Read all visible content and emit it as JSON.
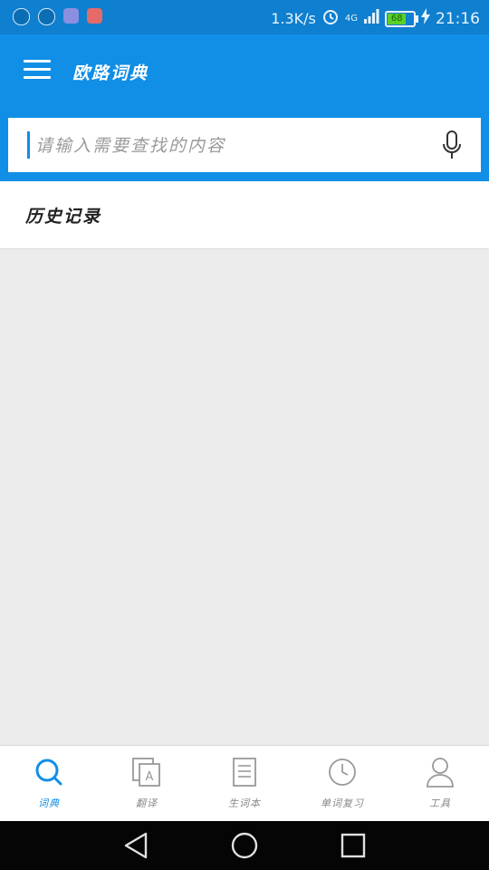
{
  "status_bar": {
    "net_speed": "1.3K/s",
    "network": "4G",
    "battery_level": "68",
    "time": "21:16"
  },
  "app_bar": {
    "title": "欧路词典",
    "menu_icon": "hamburger-menu-icon"
  },
  "search": {
    "placeholder": "请输入需要查找的内容",
    "value": "",
    "mic_icon": "microphone-icon"
  },
  "history": {
    "title": "历史记录"
  },
  "tabs": [
    {
      "label": "词典",
      "icon": "search-icon",
      "active": true
    },
    {
      "label": "翻译",
      "icon": "translate-icon",
      "active": false
    },
    {
      "label": "生词本",
      "icon": "notebook-icon",
      "active": false
    },
    {
      "label": "单词复习",
      "icon": "clock-icon",
      "active": false
    },
    {
      "label": "工具",
      "icon": "user-icon",
      "active": false
    }
  ],
  "colors": {
    "primary": "#118ee5",
    "status_bar": "#0f7fcf",
    "background": "#ececec",
    "tab_inactive": "#888888"
  }
}
